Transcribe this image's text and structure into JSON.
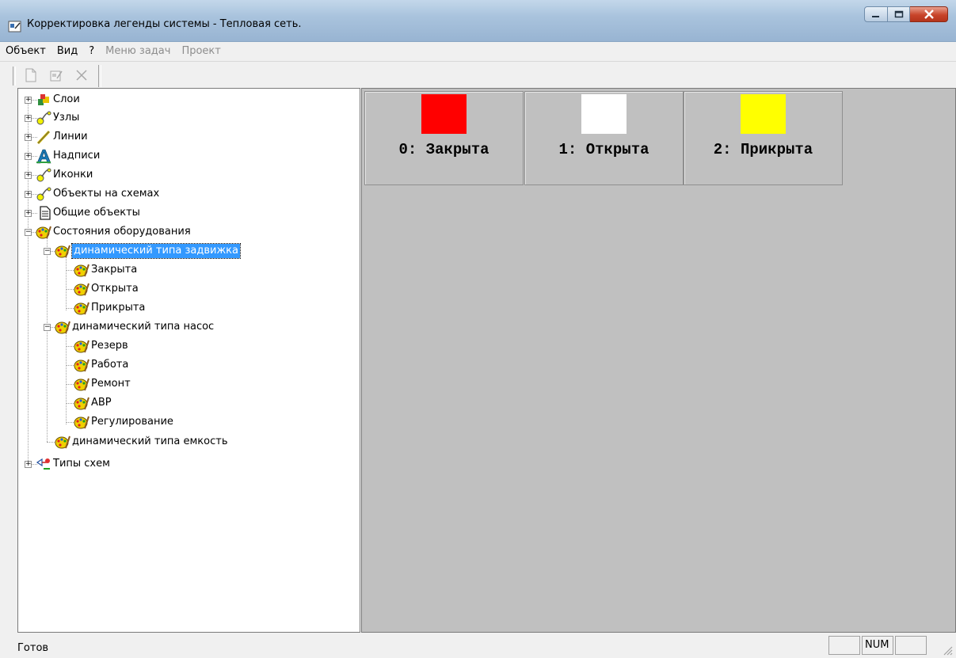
{
  "window": {
    "title": "Корректировка легенды системы - Тепловая сеть.",
    "colors": {
      "titlebar": "#a9c3dd",
      "close_button": "#c8442a"
    }
  },
  "menu": {
    "items": [
      {
        "label": "Объект",
        "enabled": true
      },
      {
        "label": "Вид",
        "enabled": true
      },
      {
        "label": "?",
        "enabled": true
      },
      {
        "label": "Меню задач",
        "enabled": false
      },
      {
        "label": "Проект",
        "enabled": false
      }
    ]
  },
  "toolbar": {
    "buttons": [
      {
        "icon": "new-document-icon",
        "enabled": false
      },
      {
        "icon": "properties-icon",
        "enabled": false
      },
      {
        "icon": "delete-icon",
        "enabled": false
      }
    ]
  },
  "tree": {
    "nodes": [
      {
        "label": "Слои",
        "icon": "layers-icon",
        "expander": "+"
      },
      {
        "label": "Узлы",
        "icon": "node-icon",
        "expander": "+"
      },
      {
        "label": "Линии",
        "icon": "line-icon",
        "expander": "+"
      },
      {
        "label": "Надписи",
        "icon": "text-A-icon",
        "expander": "+"
      },
      {
        "label": "Иконки",
        "icon": "node-icon",
        "expander": "+"
      },
      {
        "label": "Объекты на схемах",
        "icon": "node-icon",
        "expander": "+"
      },
      {
        "label": "Общие объекты",
        "icon": "document-icon",
        "expander": "+"
      },
      {
        "label": "Состояния оборудования",
        "icon": "palette-icon",
        "expander": "-"
      },
      {
        "label": "динамический типа задвижка",
        "icon": "palette-icon",
        "expander": "-",
        "selected": true
      },
      {
        "label": "Закрыта",
        "icon": "palette-icon"
      },
      {
        "label": "Открыта",
        "icon": "palette-icon"
      },
      {
        "label": "Прикрыта",
        "icon": "palette-icon"
      },
      {
        "label": "динамический типа насос",
        "icon": "palette-icon",
        "expander": "-"
      },
      {
        "label": "Резерв",
        "icon": "palette-icon"
      },
      {
        "label": "Работа",
        "icon": "palette-icon"
      },
      {
        "label": "Ремонт",
        "icon": "palette-icon"
      },
      {
        "label": "АВР",
        "icon": "palette-icon"
      },
      {
        "label": "Регулирование",
        "icon": "palette-icon"
      },
      {
        "label": "динамический типа емкость",
        "icon": "palette-icon"
      },
      {
        "label": "Типы схем",
        "icon": "scheme-types-icon",
        "expander": "+"
      }
    ]
  },
  "legend": {
    "background": "#c0c0c0",
    "cells": [
      {
        "label": "0: Закрыта",
        "color": "#ff0000"
      },
      {
        "label": "1: Открыта",
        "color": "#ffffff"
      },
      {
        "label": "2: Прикрыта",
        "color": "#ffff00"
      }
    ]
  },
  "status": {
    "text": "Готов",
    "indicators": [
      "",
      "NUM",
      ""
    ]
  }
}
